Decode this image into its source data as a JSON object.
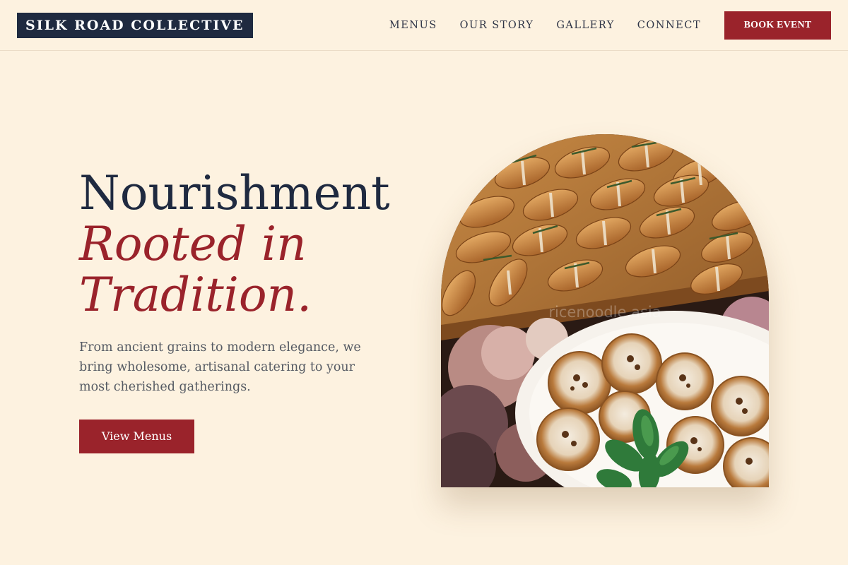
{
  "brand": {
    "name": "SILK ROAD COLLECTIVE"
  },
  "nav": {
    "items": [
      {
        "label": "MENUS"
      },
      {
        "label": "OUR STORY"
      },
      {
        "label": "GALLERY"
      },
      {
        "label": "CONNECT"
      }
    ],
    "cta_label": "BOOK EVENT"
  },
  "hero": {
    "title_line1": "Nourishment",
    "title_line2": "Rooted in",
    "title_line3": "Tradition.",
    "description": "From ancient grains to modern elegance, we bring wholesome, artisanal catering to your most cherished gatherings.",
    "cta_label": "View Menus",
    "image_watermark": "ricenoodle.asia"
  },
  "colors": {
    "background": "#fdf2e0",
    "navy": "#1f2a40",
    "accent_red": "#9a232b",
    "body_text": "#555a63"
  }
}
